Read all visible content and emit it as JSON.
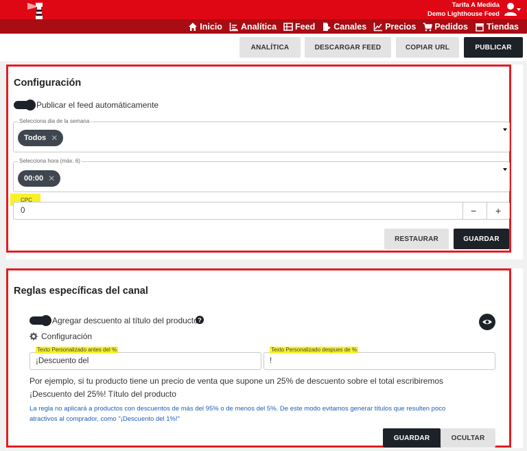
{
  "account": {
    "company": "Tarifa A Medida",
    "store": "Demo Lighthouse Feed"
  },
  "nav": [
    {
      "label": "Inicio",
      "icon": "home-icon"
    },
    {
      "label": "Analítica",
      "icon": "analytics-icon"
    },
    {
      "label": "Feed",
      "icon": "feed-icon"
    },
    {
      "label": "Canales",
      "icon": "channels-icon"
    },
    {
      "label": "Precios",
      "icon": "prices-icon"
    },
    {
      "label": "Pedidos",
      "icon": "cart-icon"
    },
    {
      "label": "Tiendas",
      "icon": "store-icon"
    }
  ],
  "actions": {
    "analitica": "ANALÍTICA",
    "descargar": "DESCARGAR FEED",
    "copiar": "COPIAR URL",
    "publicar": "PUBLICAR"
  },
  "config": {
    "title": "Configuración",
    "autopublish_label": "Publicar el feed automáticamente",
    "day_field": {
      "label": "Selecciona dia de la semana",
      "chip": "Todos"
    },
    "hour_field": {
      "label": "Selecciona hora (máx. 6)",
      "chip": "00:00"
    },
    "cpc": {
      "label": "CPC",
      "value": "0",
      "minus": "−",
      "plus": "+"
    },
    "restaurar": "RESTAURAR",
    "guardar": "GUARDAR"
  },
  "rules": {
    "title": "Reglas específicas del canal",
    "discount_label": "Agregar descuento al título del producto",
    "config_label": "Configuración",
    "before_field": {
      "label": "Texto Personalizado antes del %",
      "value": "¡Descuento del"
    },
    "after_field": {
      "label": "Texto Personalizado despues de %",
      "value": "!"
    },
    "example_line1": "Por ejemplo, si tu producto tiene un precio de venta que supone un 25% de descuento sobre el total escribiremos",
    "example_line2": "¡Descuento del 25%! Título del producto",
    "note_line1": "La regla no aplicará a productos con descuentos de más del 95% o de menos del 5%. De este modo evitamos generar títulos que resulten poco",
    "note_line2": "atractivos al comprador, como \"¡Descuento del 1%!\"",
    "guardar": "GUARDAR",
    "ocultar": "OCULTAR"
  },
  "colors": {
    "brand_red": "#e00714",
    "nav_red": "#a90c13",
    "dark_button": "#1d2128",
    "highlight": "#f7f12a",
    "note_blue": "#1f5db5"
  }
}
